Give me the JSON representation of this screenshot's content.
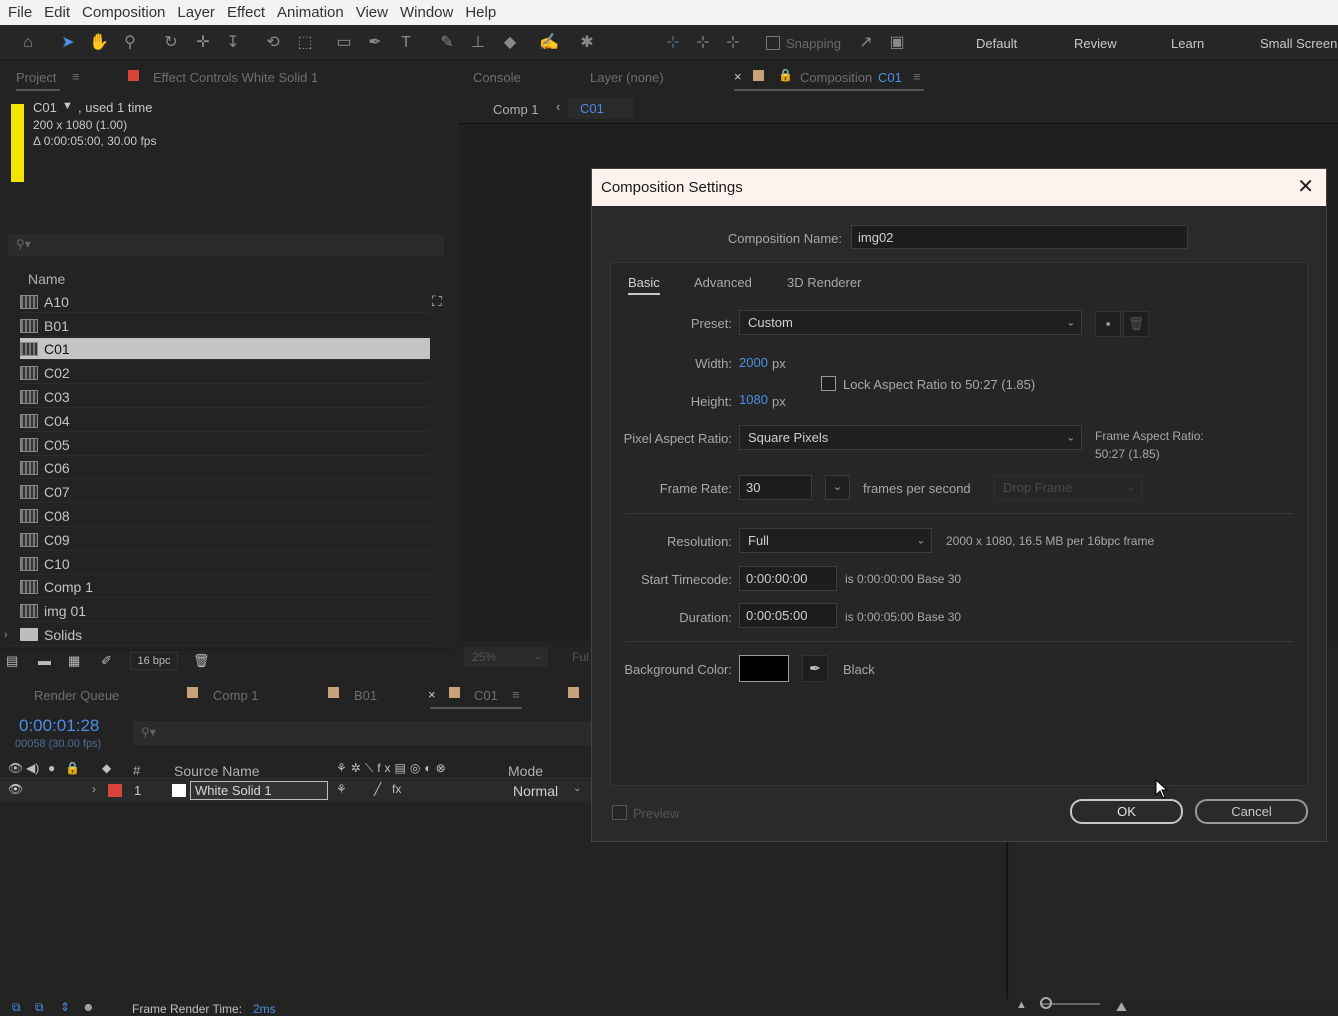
{
  "menu": [
    "File",
    "Edit",
    "Composition",
    "Layer",
    "Effect",
    "Animation",
    "View",
    "Window",
    "Help"
  ],
  "toolbar": {
    "snapping_label": "Snapping",
    "workspaces": [
      "Default",
      "Review",
      "Learn",
      "Small Screen"
    ]
  },
  "project_panel": {
    "tab_project": "Project",
    "tab_effect_controls": "Effect Controls White Solid 1",
    "selected_name": "C01",
    "selected_used": ", used 1 time",
    "selected_dims": "200 x 1080 (1.00)",
    "selected_duration": "Δ 0:00:05:00, 30.00 fps",
    "col_name": "Name",
    "items": [
      "A10",
      "B01",
      "C01",
      "C02",
      "C03",
      "C04",
      "C05",
      "C06",
      "C07",
      "C08",
      "C09",
      "C10",
      "Comp 1",
      "img 01",
      "Solids"
    ],
    "bpc": "16 bpc"
  },
  "comp_panel": {
    "tab_console": "Console",
    "tab_layer": "Layer (none)",
    "tab_composition": "Composition",
    "tab_comp_name": "C01",
    "crumb_comp1": "Comp 1",
    "crumb_c01": "C01",
    "zoom": "25%",
    "res": "Ful"
  },
  "timeline": {
    "tab_render_queue": "Render Queue",
    "tab_comp1": "Comp 1",
    "tab_b01": "B01",
    "tab_c01": "C01",
    "timecode": "0:00:01:28",
    "frames": "00058 (30.00 fps)",
    "col_num": "#",
    "col_source": "Source Name",
    "col_mode": "Mode",
    "layer_num": "1",
    "layer_name": "White Solid 1",
    "layer_mode": "Normal",
    "render_time_label": "Frame Render Time:",
    "render_time_value": "2ms"
  },
  "dialog": {
    "title": "Composition Settings",
    "name_label": "Composition Name:",
    "name_value": "img02",
    "tabs": [
      "Basic",
      "Advanced",
      "3D Renderer"
    ],
    "preset_label": "Preset:",
    "preset_value": "Custom",
    "width_label": "Width:",
    "width_value": "2000",
    "height_label": "Height:",
    "height_value": "1080",
    "px": "px",
    "lock_label": "Lock Aspect Ratio to 50:27 (1.85)",
    "par_label": "Pixel Aspect Ratio:",
    "par_value": "Square Pixels",
    "far_label": "Frame Aspect Ratio:",
    "far_value": "50:27 (1.85)",
    "fps_label": "Frame Rate:",
    "fps_value": "30",
    "fps_unit": "frames per second",
    "drop_frame": "Drop Frame",
    "res_label": "Resolution:",
    "res_value": "Full",
    "res_info": "2000 x 1080, 16.5 MB per 16bpc frame",
    "start_label": "Start Timecode:",
    "start_value": "0:00:00:00",
    "start_info": "is 0:00:00:00  Base 30",
    "dur_label": "Duration:",
    "dur_value": "0:00:05:00",
    "dur_info": "is 0:00:05:00  Base 30",
    "bg_label": "Background Color:",
    "bg_name": "Black",
    "preview_label": "Preview",
    "ok": "OK",
    "cancel": "Cancel"
  },
  "colors": {
    "accent": "#4c8ee6",
    "label_yellow": "#f2e600",
    "label_red": "#d9443a",
    "label_tan": "#c8a27a"
  }
}
